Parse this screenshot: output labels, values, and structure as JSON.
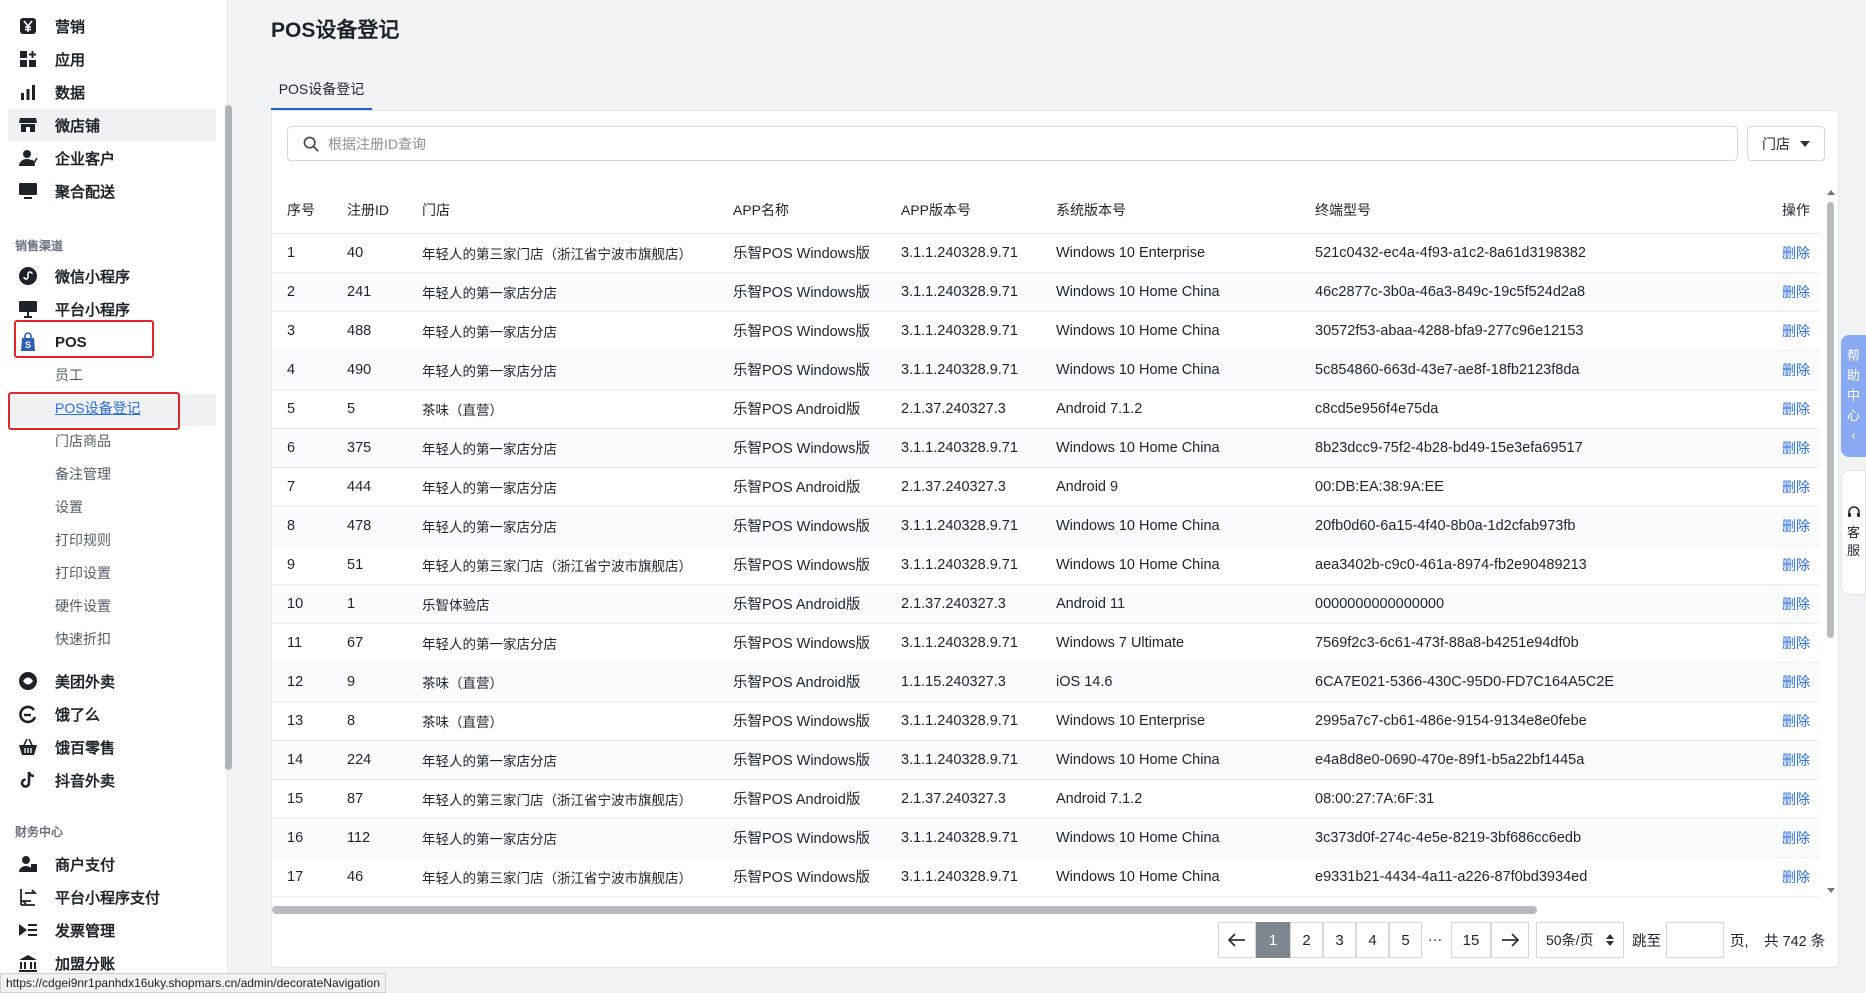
{
  "sidebar": {
    "items_top": [
      {
        "label": "营销",
        "icon": "yen-icon"
      },
      {
        "label": "应用",
        "icon": "apps-icon"
      },
      {
        "label": "数据",
        "icon": "bar-chart-icon"
      },
      {
        "label": "微店铺",
        "icon": "store-icon"
      },
      {
        "label": "企业客户",
        "icon": "user-icon"
      },
      {
        "label": "聚合配送",
        "icon": "monitor-icon"
      }
    ],
    "section_sales": "销售渠道",
    "items_sales": [
      {
        "label": "微信小程序",
        "icon": "wechat-mini-icon"
      },
      {
        "label": "平台小程序",
        "icon": "platform-mini-icon"
      },
      {
        "label": "POS",
        "icon": "shopping-bag-icon"
      }
    ],
    "pos_sub": [
      "员工",
      "POS设备登记",
      "门店商品",
      "备注管理",
      "设置",
      "打印规则",
      "打印设置",
      "硬件设置",
      "快速折扣"
    ],
    "items_delivery": [
      {
        "label": "美团外卖",
        "icon": "meituan-icon"
      },
      {
        "label": "饿了么",
        "icon": "eleme-icon"
      },
      {
        "label": "饿百零售",
        "icon": "basket-icon"
      },
      {
        "label": "抖音外卖",
        "icon": "tiktok-icon"
      }
    ],
    "section_finance": "财务中心",
    "items_finance": [
      {
        "label": "商户支付",
        "icon": "wallet-icon"
      },
      {
        "label": "平台小程序支付",
        "icon": "transfer-icon"
      },
      {
        "label": "发票管理",
        "icon": "invoice-icon"
      },
      {
        "label": "加盟分账",
        "icon": "bank-icon"
      }
    ]
  },
  "page": {
    "title": "POS设备登记",
    "tab": "POS设备登记"
  },
  "search": {
    "placeholder": "根据注册ID查询"
  },
  "store_filter": {
    "label": "门店"
  },
  "table": {
    "headers": [
      "序号",
      "注册ID",
      "门店",
      "APP名称",
      "APP版本号",
      "系统版本号",
      "终端型号",
      "操作"
    ],
    "rows": [
      [
        "1",
        "40",
        "年轻人的第三家门店（浙江省宁波市旗舰店）",
        "乐智POS Windows版",
        "3.1.1.240328.9.71",
        "Windows 10 Enterprise",
        "521c0432-ec4a-4f93-a1c2-8a61d3198382",
        "删除"
      ],
      [
        "2",
        "241",
        "年轻人的第一家店分店",
        "乐智POS Windows版",
        "3.1.1.240328.9.71",
        "Windows 10 Home China",
        "46c2877c-3b0a-46a3-849c-19c5f524d2a8",
        "删除"
      ],
      [
        "3",
        "488",
        "年轻人的第一家店分店",
        "乐智POS Windows版",
        "3.1.1.240328.9.71",
        "Windows 10 Home China",
        "30572f53-abaa-4288-bfa9-277c96e12153",
        "删除"
      ],
      [
        "4",
        "490",
        "年轻人的第一家店分店",
        "乐智POS Windows版",
        "3.1.1.240328.9.71",
        "Windows 10 Home China",
        "5c854860-663d-43e7-ae8f-18fb2123f8da",
        "删除"
      ],
      [
        "5",
        "5",
        "茶味（直营）",
        "乐智POS Android版",
        "2.1.37.240327.3",
        "Android 7.1.2",
        "c8cd5e956f4e75da",
        "删除"
      ],
      [
        "6",
        "375",
        "年轻人的第一家店分店",
        "乐智POS Windows版",
        "3.1.1.240328.9.71",
        "Windows 10 Home China",
        "8b23dcc9-75f2-4b28-bd49-15e3efa69517",
        "删除"
      ],
      [
        "7",
        "444",
        "年轻人的第一家店分店",
        "乐智POS Android版",
        "2.1.37.240327.3",
        "Android 9",
        "00:DB:EA:38:9A:EE",
        "删除"
      ],
      [
        "8",
        "478",
        "年轻人的第一家店分店",
        "乐智POS Windows版",
        "3.1.1.240328.9.71",
        "Windows 10 Home China",
        "20fb0d60-6a15-4f40-8b0a-1d2cfab973fb",
        "删除"
      ],
      [
        "9",
        "51",
        "年轻人的第三家门店（浙江省宁波市旗舰店）",
        "乐智POS Windows版",
        "3.1.1.240328.9.71",
        "Windows 10 Home China",
        "aea3402b-c9c0-461a-8974-fb2e90489213",
        "删除"
      ],
      [
        "10",
        "1",
        "乐智体验店",
        "乐智POS Android版",
        "2.1.37.240327.3",
        "Android 11",
        "0000000000000000",
        "删除"
      ],
      [
        "11",
        "67",
        "年轻人的第一家店分店",
        "乐智POS Windows版",
        "3.1.1.240328.9.71",
        "Windows 7 Ultimate",
        "7569f2c3-6c61-473f-88a8-b4251e94df0b",
        "删除"
      ],
      [
        "12",
        "9",
        "茶味（直营）",
        "乐智POS Android版",
        "1.1.15.240327.3",
        "iOS 14.6",
        "6CA7E021-5366-430C-95D0-FD7C164A5C2E",
        "删除"
      ],
      [
        "13",
        "8",
        "茶味（直营）",
        "乐智POS Windows版",
        "3.1.1.240328.9.71",
        "Windows 10 Enterprise",
        "2995a7c7-cb61-486e-9154-9134e8e0febe",
        "删除"
      ],
      [
        "14",
        "224",
        "年轻人的第一家店分店",
        "乐智POS Windows版",
        "3.1.1.240328.9.71",
        "Windows 10 Home China",
        "e4a8d8e0-0690-470e-89f1-b5a22bf1445a",
        "删除"
      ],
      [
        "15",
        "87",
        "年轻人的第三家门店（浙江省宁波市旗舰店）",
        "乐智POS Android版",
        "2.1.37.240327.3",
        "Android 7.1.2",
        "08:00:27:7A:6F:31",
        "删除"
      ],
      [
        "16",
        "112",
        "年轻人的第一家店分店",
        "乐智POS Windows版",
        "3.1.1.240328.9.71",
        "Windows 10 Home China",
        "3c373d0f-274c-4e5e-8219-3bf686cc6edb",
        "删除"
      ],
      [
        "17",
        "46",
        "年轻人的第三家门店（浙江省宁波市旗舰店）",
        "乐智POS Windows版",
        "3.1.1.240328.9.71",
        "Windows 10 Home China",
        "e9331b21-4434-4a11-a226-87f0bd3934ed",
        "删除"
      ]
    ]
  },
  "pagination": {
    "pages": [
      "1",
      "2",
      "3",
      "4",
      "5"
    ],
    "ellipsis": "···",
    "last_page": "15",
    "current": "1",
    "page_size": "50条/页",
    "jump_label": "跳至",
    "page_unit": "页,",
    "total": "共 742 条"
  },
  "floating": {
    "help": [
      "帮",
      "助",
      "中",
      "心",
      "‹"
    ],
    "service": [
      "客",
      "服"
    ]
  },
  "statusbar": {
    "url": "https://cdgei9nr1panhdx16uky.shopmars.cn/admin/decorateNavigation"
  },
  "colors": {
    "accent": "#2f6fdb",
    "highlight_box": "#e0262b",
    "pager_current": "#7f8790",
    "help_bg": "#8aa9f5"
  }
}
